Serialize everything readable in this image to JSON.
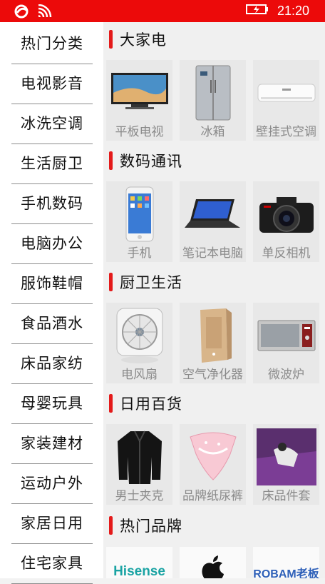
{
  "status_bar": {
    "time": "21:20",
    "background": "#ec0a0a"
  },
  "sidebar": {
    "items": [
      {
        "label": "热门分类"
      },
      {
        "label": "电视影音"
      },
      {
        "label": "冰洗空调"
      },
      {
        "label": "生活厨卫"
      },
      {
        "label": "手机数码"
      },
      {
        "label": "电脑办公"
      },
      {
        "label": "服饰鞋帽"
      },
      {
        "label": "食品酒水"
      },
      {
        "label": "床品家纺"
      },
      {
        "label": "母婴玩具"
      },
      {
        "label": "家装建材"
      },
      {
        "label": "运动户外"
      },
      {
        "label": "家居日用"
      },
      {
        "label": "住宅家具"
      }
    ]
  },
  "sections": [
    {
      "title": "大家电",
      "items": [
        {
          "label": "平板电视",
          "icon": "flat-tv-image"
        },
        {
          "label": "冰箱",
          "icon": "refrigerator-image"
        },
        {
          "label": "壁挂式空调",
          "icon": "air-conditioner-image"
        }
      ]
    },
    {
      "title": "数码通讯",
      "items": [
        {
          "label": "手机",
          "icon": "smartphone-image"
        },
        {
          "label": "笔记本电脑",
          "icon": "laptop-image"
        },
        {
          "label": "单反相机",
          "icon": "dslr-camera-image"
        }
      ]
    },
    {
      "title": "厨卫生活",
      "items": [
        {
          "label": "电风扇",
          "icon": "electric-fan-image"
        },
        {
          "label": "空气净化器",
          "icon": "air-purifier-image"
        },
        {
          "label": "微波炉",
          "icon": "microwave-image"
        }
      ]
    },
    {
      "title": "日用百货",
      "items": [
        {
          "label": "男士夹克",
          "icon": "jacket-image"
        },
        {
          "label": "品牌纸尿裤",
          "icon": "diaper-image"
        },
        {
          "label": "床品件套",
          "icon": "bedding-image"
        }
      ]
    },
    {
      "title": "热门品牌",
      "brands": [
        {
          "label": "Hisense",
          "icon": "hisense-logo"
        },
        {
          "label": "",
          "icon": "apple-logo"
        },
        {
          "label": "ROBAM老板",
          "icon": "robam-logo"
        }
      ]
    }
  ],
  "colors": {
    "accent": "#e41a1a",
    "card_background": "#e8e8e8",
    "label_gray": "#8a8a8a"
  }
}
